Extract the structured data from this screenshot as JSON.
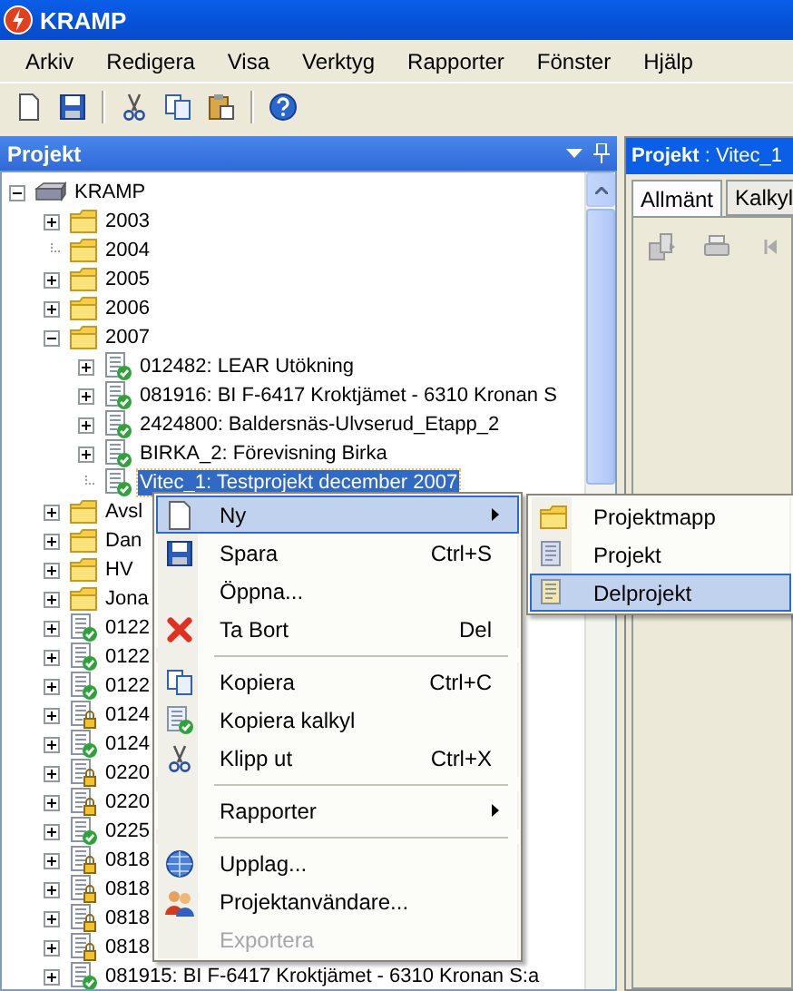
{
  "window": {
    "title": "KRAMP"
  },
  "menu_bar": [
    "Arkiv",
    "Redigera",
    "Visa",
    "Verktyg",
    "Rapporter",
    "Fönster",
    "Hjälp"
  ],
  "toolbar": [
    {
      "kind": "new"
    },
    {
      "kind": "save"
    },
    {
      "kind": "separator"
    },
    {
      "kind": "cut"
    },
    {
      "kind": "copy"
    },
    {
      "kind": "paste"
    },
    {
      "kind": "separator"
    },
    {
      "kind": "help"
    }
  ],
  "project_panel": {
    "title": "Projekt",
    "tree": [
      {
        "label": "KRAMP",
        "kind": "root",
        "expandable": true,
        "expanded": true,
        "selected": false,
        "children": [
          {
            "label": "2003",
            "kind": "folder",
            "expandable": true,
            "expanded": false,
            "selected": false
          },
          {
            "label": "2004",
            "kind": "folder",
            "expandable": false,
            "selected": false
          },
          {
            "label": "2005",
            "kind": "folder",
            "expandable": true,
            "expanded": false,
            "selected": false
          },
          {
            "label": "2006",
            "kind": "folder",
            "expandable": true,
            "expanded": false,
            "selected": false
          },
          {
            "label": "2007",
            "kind": "folder",
            "expandable": true,
            "expanded": true,
            "selected": false,
            "children": [
              {
                "label": "012482: LEAR Utökning",
                "kind": "project_ok",
                "expandable": true,
                "expanded": false,
                "selected": false
              },
              {
                "label": "081916: BI F-6417 Kroktjämet - 6310 Kronan S",
                "kind": "project_ok",
                "expandable": true,
                "expanded": false,
                "selected": false
              },
              {
                "label": "2424800: Baldersnäs-Ulvserud_Etapp_2",
                "kind": "project_ok",
                "expandable": true,
                "expanded": false,
                "selected": false
              },
              {
                "label": "BIRKA_2: Förevisning Birka",
                "kind": "project_ok",
                "expandable": true,
                "expanded": false,
                "selected": false
              },
              {
                "label": "Vitec_1: Testprojekt december 2007",
                "kind": "project_ok",
                "expandable": false,
                "selected": true
              }
            ]
          },
          {
            "label": "Avsl",
            "kind": "folder",
            "expandable": true,
            "expanded": false,
            "selected": false
          },
          {
            "label": "Dan",
            "kind": "folder",
            "expandable": true,
            "expanded": false,
            "selected": false
          },
          {
            "label": "HV",
            "kind": "folder",
            "expandable": true,
            "expanded": false,
            "selected": false
          },
          {
            "label": "Jona",
            "kind": "folder",
            "expandable": true,
            "expanded": false,
            "selected": false
          },
          {
            "label": "0122",
            "kind": "project_ok",
            "expandable": true,
            "expanded": false,
            "selected": false
          },
          {
            "label": "0122",
            "kind": "project_ok",
            "expandable": true,
            "expanded": false,
            "selected": false
          },
          {
            "label": "0122",
            "kind": "project_ok",
            "expandable": true,
            "expanded": false,
            "selected": false
          },
          {
            "label": "0124",
            "kind": "project_locked",
            "expandable": true,
            "expanded": false,
            "selected": false
          },
          {
            "label": "0124",
            "kind": "project_ok",
            "expandable": true,
            "expanded": false,
            "selected": false
          },
          {
            "label": "0220",
            "kind": "project_locked",
            "expandable": true,
            "expanded": false,
            "selected": false
          },
          {
            "label": "0220",
            "kind": "project_locked",
            "expandable": true,
            "expanded": false,
            "selected": false
          },
          {
            "label": "0225",
            "kind": "project_ok",
            "expandable": true,
            "expanded": false,
            "selected": false
          },
          {
            "label": "0818",
            "kind": "project_locked",
            "expandable": true,
            "expanded": false,
            "selected": false
          },
          {
            "label": "0818",
            "kind": "project_locked",
            "expandable": true,
            "expanded": false,
            "selected": false
          },
          {
            "label": "0818",
            "kind": "project_locked",
            "expandable": true,
            "expanded": false,
            "selected": false
          },
          {
            "label": "0818",
            "kind": "project_locked",
            "expandable": true,
            "expanded": false,
            "selected": false
          },
          {
            "label": "081915: BI F-6417 Kroktjämet - 6310 Kronan S:a",
            "kind": "project_ok",
            "expandable": true,
            "expanded": false,
            "selected": false
          }
        ]
      }
    ]
  },
  "detail_panel": {
    "title": "**Projekt** : Vitec_1",
    "tabs": [
      {
        "label": "Allmänt",
        "selected": true
      },
      {
        "label": "Kalkyl",
        "selected": false
      }
    ],
    "toolbar": [
      {
        "kind": "export"
      },
      {
        "kind": "print"
      },
      {
        "kind": "first"
      }
    ]
  },
  "context_menu": [
    {
      "kind": "item",
      "label": "Ny",
      "submenu": true,
      "selected": true,
      "disabled": false
    },
    {
      "kind": "item",
      "label": "Spara",
      "shortcut": "Ctrl+S",
      "submenu": false,
      "selected": false,
      "disabled": false
    },
    {
      "kind": "item",
      "label": "Öppna...",
      "submenu": false,
      "selected": false,
      "disabled": false
    },
    {
      "kind": "item",
      "label": "Ta Bort",
      "shortcut": "Del",
      "submenu": false,
      "selected": false,
      "disabled": false
    },
    {
      "kind": "separator"
    },
    {
      "kind": "item",
      "label": "Kopiera",
      "shortcut": "Ctrl+C",
      "submenu": false,
      "selected": false,
      "disabled": false
    },
    {
      "kind": "item",
      "label": "Kopiera kalkyl",
      "submenu": false,
      "selected": false,
      "disabled": false
    },
    {
      "kind": "item",
      "label": "Klipp ut",
      "shortcut": "Ctrl+X",
      "submenu": false,
      "selected": false,
      "disabled": false
    },
    {
      "kind": "separator"
    },
    {
      "kind": "item",
      "label": "Rapporter",
      "submenu": true,
      "selected": false,
      "disabled": false
    },
    {
      "kind": "separator"
    },
    {
      "kind": "item",
      "label": "Upplag...",
      "submenu": false,
      "selected": false,
      "disabled": false
    },
    {
      "kind": "item",
      "label": "Projektanvändare...",
      "submenu": false,
      "selected": false,
      "disabled": false
    },
    {
      "kind": "item",
      "label": "Exportera",
      "submenu": false,
      "selected": false,
      "disabled": true
    }
  ],
  "submenu": [
    {
      "label": "Projektmapp",
      "selected": false
    },
    {
      "label": "Projekt",
      "selected": false
    },
    {
      "label": "Delprojekt",
      "selected": true
    }
  ]
}
